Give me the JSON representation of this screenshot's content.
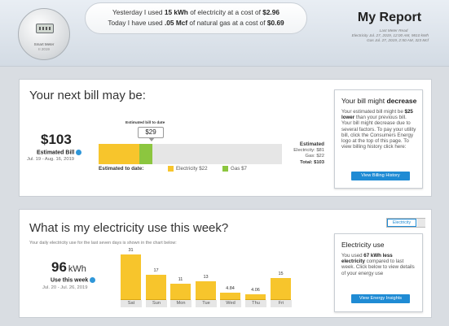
{
  "header": {
    "meter": {
      "label": "Smart Meter",
      "sub": "II 2019"
    },
    "message": {
      "line1_pre": "Yesterday I used ",
      "line1_kwh": "15 kWh",
      "line1_mid": " of electricity at a cost of ",
      "line1_cost": "$2.96",
      "line2_pre": "Today I have used ",
      "line2_mcf": ".05 Mcf",
      "line2_mid": " of natural gas at a cost of ",
      "line2_cost": "$0.69"
    },
    "report_title": "My Report",
    "last_read_label": "Last Meter Read",
    "last_read_electric": "Electricity Jul. 27, 2019, 12:00 AM, 9810 kWh",
    "last_read_gas": "Gas Jul. 27, 2019, 2:50 AM, 323 Mcf"
  },
  "bill": {
    "title": "Your next bill may be:",
    "amount": "$103",
    "amount_label": "Estimated Bill",
    "dates": "Jul. 19 - Aug. 16, 2019",
    "callout_label": "Estimated bill to date",
    "callout_value": "$29",
    "todate_label": "Estimated to date:",
    "legend": [
      {
        "label": "Electricity $22",
        "color": "#f7c52c"
      },
      {
        "label": "Gas $7",
        "color": "#8cc63f"
      }
    ],
    "estimate_total": 103,
    "segments": [
      {
        "name": "Electricity",
        "value": 22,
        "color": "#f7c52c"
      },
      {
        "name": "Gas",
        "value": 7,
        "color": "#8cc63f"
      }
    ],
    "estimated_col": {
      "heading": "Estimated",
      "electricity": "Electricity: $81",
      "gas": "Gas: $22",
      "total": "Total: $103"
    },
    "card": {
      "title_pre": "Your bill might ",
      "title_bold": "decrease",
      "body_pre": "Your estimated bill might be ",
      "body_bold": "$25 lower",
      "body_post": " than your previous bill. Your bill might decrease due to several factors. To pay your utility bill, click the Consumers Energy logo at the top of this page. To view billing history click here:",
      "button": "View Billing History"
    }
  },
  "usage": {
    "title": "What is my electricity use this week?",
    "subtitle": "Your daily electricity use for the last seven days is shown in the chart below:",
    "toggle_on": "Electricity",
    "total_value": "96",
    "total_unit": "kWh",
    "week_label": "Use this week",
    "week_dates": "Jul. 20 - Jul. 26, 2019",
    "card": {
      "title": "Electricity use",
      "body_pre": "You used ",
      "body_bold": "67 kWh less electricity",
      "body_post": " compared to last week. Click below to view details of your energy use",
      "button": "View Energy Insights"
    }
  },
  "chart_data": {
    "type": "bar",
    "categories": [
      "Sat",
      "Sun",
      "Mon",
      "Tue",
      "Wed",
      "Thu",
      "Fri"
    ],
    "values": [
      31,
      17,
      11,
      13,
      4.84,
      4.06,
      15
    ],
    "value_labels": [
      "31",
      "17",
      "11",
      "13",
      "4.84",
      "4.06",
      "15"
    ],
    "title": "",
    "xlabel": "",
    "ylabel": "",
    "ylim": [
      0,
      31
    ],
    "color": "#f7c52c",
    "grid": false
  }
}
